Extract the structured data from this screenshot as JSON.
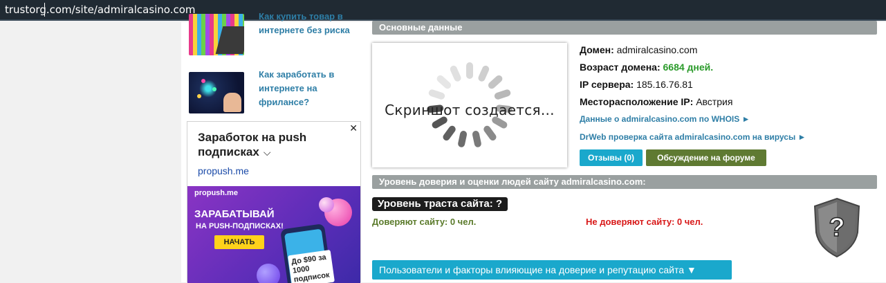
{
  "browser": {
    "url": "trustorg.com/site/admiralcasino.com"
  },
  "sidebar": {
    "news": [
      {
        "title": "Как купить товар в интернете без риска"
      },
      {
        "title": "Как заработать в интернете на фрилансе?"
      }
    ]
  },
  "ad": {
    "close_label": "✕",
    "title": "Заработок на push подписках",
    "chevron": "⌵",
    "domain": "propush.me",
    "banner": {
      "brand": "propush.me",
      "headline": "ЗАРАБАТЫВАЙ",
      "sub": "НА PUSH-ПОДПИСКАХ!",
      "cta": "НАЧАТЬ",
      "offer": "До $90 за 1000 подписок"
    }
  },
  "main": {
    "section_basic": "Основные данные",
    "screenshot_caption": "Скриншот создается...",
    "domain_label": "Домен:",
    "domain_value": "admiralcasino.com",
    "age_label": "Возраст домена:",
    "age_value": "6684 дней.",
    "ip_label": "IP сервера:",
    "ip_value": "185.16.76.81",
    "location_label": "Месторасположение IP:",
    "location_value": "Австрия",
    "whois_link": "Данные о admiralcasino.com по WHOIS ►",
    "drweb_link": "DrWeb проверка сайта admiralcasino.com на вирусы ►",
    "reviews_button": "Отзывы (0)",
    "forum_button": "Обсуждение на форуме",
    "section_trust": "Уровень доверия и оценки людей сайту admiralcasino.com:",
    "trust_level": "Уровень траста сайта: ?",
    "trust_yes": "Доверяют сайту: 0 чел.",
    "trust_no": "Не доверяют сайту: 0 чел.",
    "shield_mark": "?",
    "factors_button": "Пользователи и факторы влияющие на доверие и репутацию сайта ▼"
  },
  "colors": {
    "link": "#2e7ea6",
    "section_bar": "#9aa0a0",
    "reviews_button": "#1aa8cc",
    "forum_button": "#5f7a32",
    "green": "#2a9a2a",
    "red": "#d81818"
  }
}
